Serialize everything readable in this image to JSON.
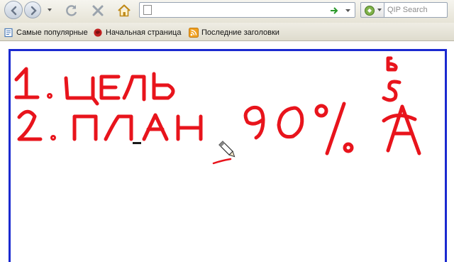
{
  "toolbar": {
    "back_icon": "back-arrow-icon",
    "forward_icon": "forward-arrow-icon",
    "reload_icon": "reload-icon",
    "stop_icon": "stop-icon",
    "home_icon": "home-icon",
    "address_value": "",
    "search_engine_icon": "qip-search-engine-icon",
    "search_placeholder": "QIP Search"
  },
  "bookmarks": [
    {
      "label": "Самые популярные",
      "icon": "bookmark-folder-icon"
    },
    {
      "label": "Начальная страница",
      "icon": "start-page-icon"
    },
    {
      "label": "Последние заголовки",
      "icon": "rss-feed-icon"
    }
  ],
  "whiteboard": {
    "frame_color": "#1b2ad0",
    "ink_color": "#e8141c",
    "cursor_icon": "pencil-cursor-icon",
    "handwritten_lines": [
      {
        "text": "1. ЦЕЛЬ"
      },
      {
        "text": "2. ПЛАН"
      }
    ],
    "percent_note": "90%",
    "side_letters": [
      "Б",
      "S",
      "А"
    ]
  }
}
